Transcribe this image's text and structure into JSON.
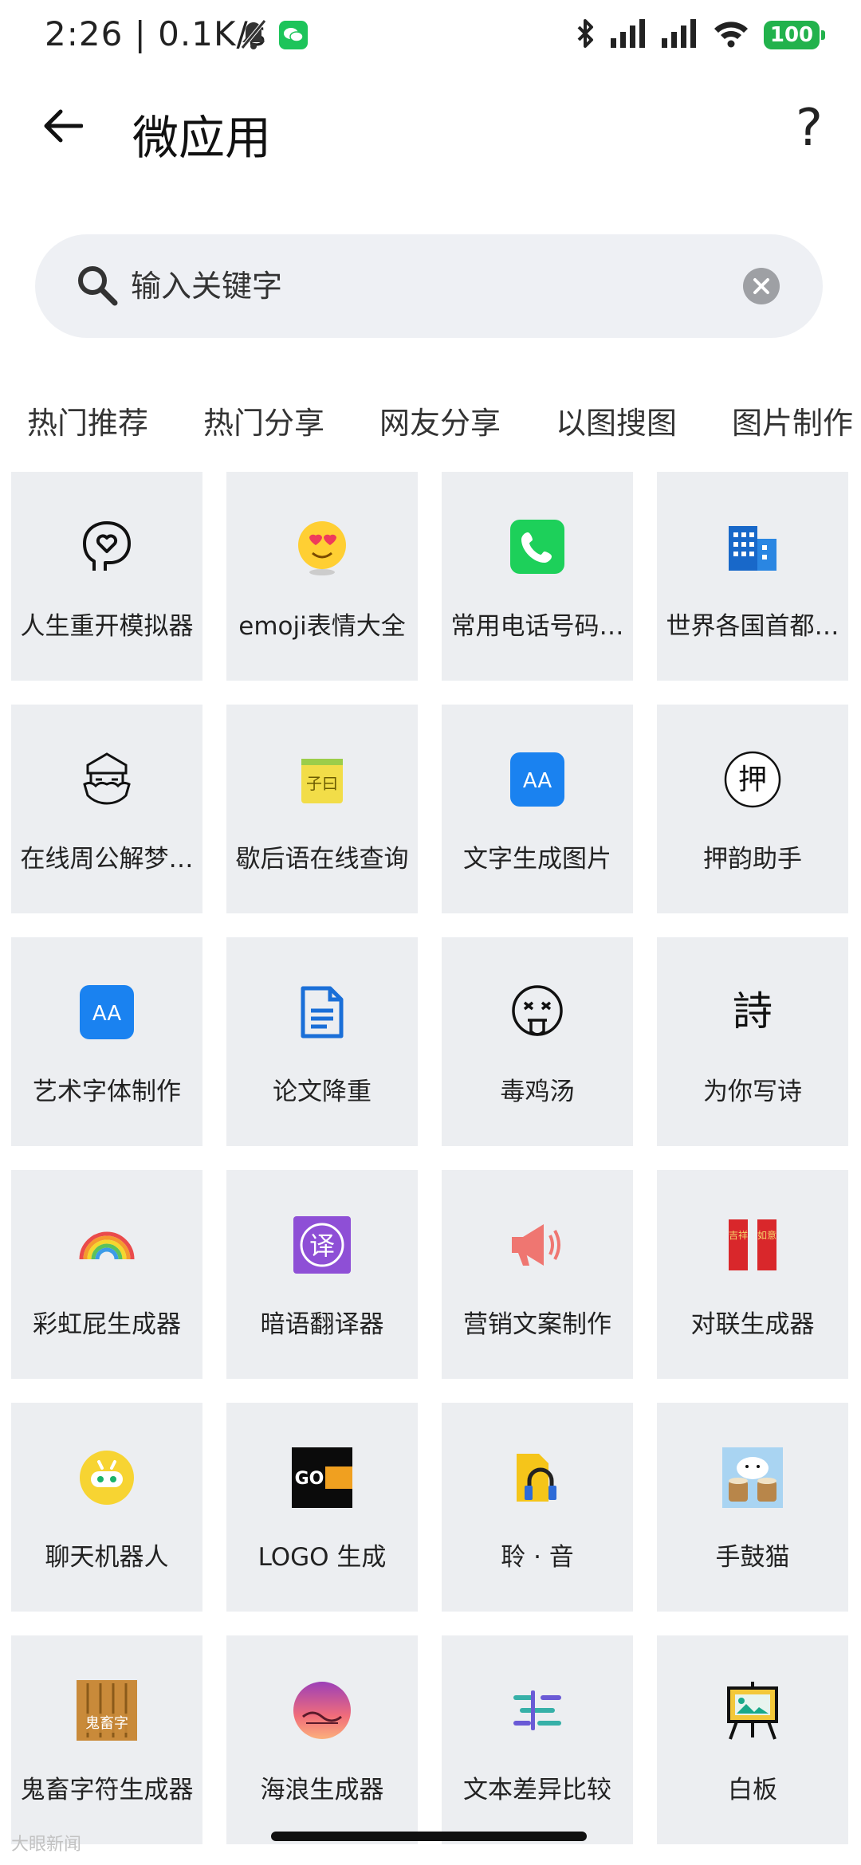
{
  "status_bar": {
    "time": "2:26 | 0.1K/s",
    "battery": "100",
    "icons": [
      "bell-mute-icon",
      "wechat-icon",
      "bluetooth-icon",
      "signal-icon",
      "signal-icon",
      "wifi-icon",
      "battery-icon"
    ]
  },
  "header": {
    "title": "微应用",
    "help": "?"
  },
  "search": {
    "placeholder": "输入关键字"
  },
  "tabs": [
    "热门推荐",
    "热门分享",
    "网友分享",
    "以图搜图",
    "图片制作"
  ],
  "apps": [
    {
      "label": "人生重开模拟器",
      "icon": "head-heart-icon"
    },
    {
      "label": "emoji表情大全",
      "icon": "emoji-face-icon"
    },
    {
      "label": "常用电话号码…",
      "icon": "phone-icon"
    },
    {
      "label": "世界各国首都…",
      "icon": "building-icon"
    },
    {
      "label": "在线周公解梦…",
      "icon": "old-man-icon"
    },
    {
      "label": "歇后语在线查询",
      "icon": "note-icon"
    },
    {
      "label": "文字生成图片",
      "icon": "text-aa-icon"
    },
    {
      "label": "押韵助手",
      "icon": "ya-char-icon"
    },
    {
      "label": "艺术字体制作",
      "icon": "text-aa-icon"
    },
    {
      "label": "论文降重",
      "icon": "document-icon"
    },
    {
      "label": "毒鸡汤",
      "icon": "dizzy-face-icon"
    },
    {
      "label": "为你写诗",
      "icon": "poem-char-icon"
    },
    {
      "label": "彩虹屁生成器",
      "icon": "rainbow-icon"
    },
    {
      "label": "暗语翻译器",
      "icon": "translate-icon"
    },
    {
      "label": "营销文案制作",
      "icon": "megaphone-icon"
    },
    {
      "label": "对联生成器",
      "icon": "couplet-icon"
    },
    {
      "label": "聊天机器人",
      "icon": "robot-icon"
    },
    {
      "label": "LOGO 生成",
      "icon": "logo-gen-icon"
    },
    {
      "label": "聆 · 音",
      "icon": "headphone-file-icon"
    },
    {
      "label": "手鼓猫",
      "icon": "bongo-cat-icon"
    },
    {
      "label": "鬼畜字符生成器",
      "icon": "gui-char-icon"
    },
    {
      "label": "海浪生成器",
      "icon": "wave-icon"
    },
    {
      "label": "文本差异比较",
      "icon": "diff-icon"
    },
    {
      "label": "白板",
      "icon": "whiteboard-icon"
    }
  ],
  "icon_text": {
    "ya": "押",
    "shi": "詩",
    "aa": "AA",
    "yi": "译",
    "go": "GO",
    "gui": "鬼畜字",
    "zi": "子曰",
    "couplet_left": "吉祥",
    "couplet_right": "如意"
  },
  "colors": {
    "card_bg": "#eceef1",
    "search_bg": "#eef0f4",
    "battery": "#22b24c"
  },
  "watermark": "大眼新闻"
}
